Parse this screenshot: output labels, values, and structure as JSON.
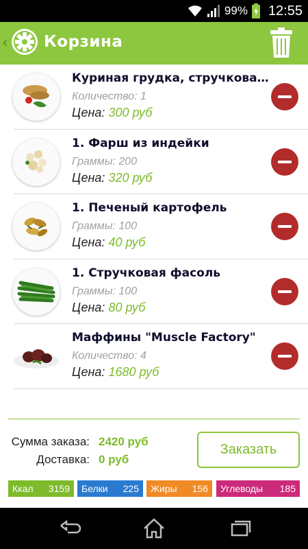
{
  "status_bar": {
    "battery_percent": "99%",
    "time": "12:55",
    "icons": [
      "wifi-icon",
      "signal-icon",
      "battery-icon"
    ]
  },
  "app_bar": {
    "title": "Корзина",
    "logo_icon": "gear-icon",
    "back_icon": "chevron-left-icon",
    "trash_icon": "trash-icon",
    "background": "#8dc63f"
  },
  "cart": {
    "items": [
      {
        "name": "Куриная грудка, стручковая...",
        "sub_label": "Количество: 1",
        "price_label": "Цена:",
        "price": "300 руб",
        "image": "chicken-breast-plate"
      },
      {
        "name": "1. Фарш из индейки",
        "sub_label": "Граммы: 200",
        "price_label": "Цена:",
        "price": "320 руб",
        "image": "turkey-mince-plate"
      },
      {
        "name": "1. Печеный картофель",
        "sub_label": "Граммы: 100",
        "price_label": "Цена:",
        "price": "40 руб",
        "image": "baked-potato-plate"
      },
      {
        "name": "1. Стручковая фасоль",
        "sub_label": "Граммы: 100",
        "price_label": "Цена:",
        "price": "80 руб",
        "image": "green-beans-plate"
      },
      {
        "name": "Маффины \"Muscle Factory\"",
        "sub_label": "Количество: 4",
        "price_label": "Цена:",
        "price": "1680 руб",
        "image": "muffins-plate"
      }
    ]
  },
  "summary": {
    "total_label": "Сумма заказа:",
    "total_value": "2420 руб",
    "delivery_label": "Доставка:",
    "delivery_value": "0 руб",
    "order_button": "Заказать"
  },
  "nutrition": [
    {
      "label": "Ккал",
      "value": "3159",
      "color": "#7dbb2b"
    },
    {
      "label": "Белки",
      "value": "225",
      "color": "#2a7bd0"
    },
    {
      "label": "Жиры",
      "value": "156",
      "color": "#f08a24"
    },
    {
      "label": "Углеводы",
      "value": "185",
      "color": "#cc2a7a"
    }
  ],
  "nav_bar": {
    "icons": [
      "back-icon",
      "home-icon",
      "recent-apps-icon"
    ]
  }
}
